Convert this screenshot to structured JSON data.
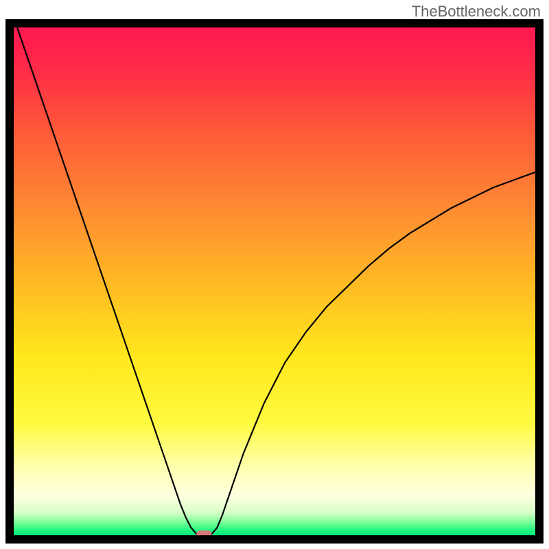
{
  "watermark": "TheBottleneck.com",
  "chart_data": {
    "type": "line",
    "title": "",
    "xlabel": "",
    "ylabel": "",
    "xlim": [
      0,
      100
    ],
    "ylim": [
      0,
      100
    ],
    "x": [
      0,
      2,
      4,
      6,
      8,
      10,
      12,
      14,
      16,
      18,
      20,
      22,
      24,
      26,
      28,
      30,
      32,
      33,
      34,
      35,
      36,
      37,
      38,
      39,
      40,
      42,
      44,
      46,
      48,
      50,
      52,
      56,
      60,
      64,
      68,
      72,
      76,
      80,
      84,
      88,
      92,
      96,
      100
    ],
    "values": [
      102,
      96,
      90,
      84,
      78,
      72,
      66,
      60,
      54,
      48,
      42,
      36,
      30,
      24,
      18,
      12,
      6,
      3.5,
      1.5,
      0.3,
      0.1,
      0.1,
      0.3,
      1.5,
      4,
      10,
      16,
      21,
      26,
      30,
      34,
      40,
      45,
      49,
      53,
      56.5,
      59.5,
      62,
      64.5,
      66.5,
      68.5,
      70,
      71.5
    ],
    "marker": {
      "x": 36.5,
      "y": 0.2,
      "color": "#d87878",
      "shape": "rounded-rect"
    },
    "gradient_stops": [
      {
        "offset": 0.0,
        "color": "#ff1850"
      },
      {
        "offset": 0.08,
        "color": "#ff2a48"
      },
      {
        "offset": 0.2,
        "color": "#ff5838"
      },
      {
        "offset": 0.35,
        "color": "#ff8833"
      },
      {
        "offset": 0.5,
        "color": "#ffb924"
      },
      {
        "offset": 0.65,
        "color": "#ffe81c"
      },
      {
        "offset": 0.78,
        "color": "#fffa40"
      },
      {
        "offset": 0.86,
        "color": "#ffffa8"
      },
      {
        "offset": 0.92,
        "color": "#ffffe0"
      },
      {
        "offset": 0.955,
        "color": "#d8ffc8"
      },
      {
        "offset": 0.975,
        "color": "#78ff98"
      },
      {
        "offset": 0.99,
        "color": "#20f880"
      },
      {
        "offset": 1.0,
        "color": "#08e878"
      }
    ]
  }
}
